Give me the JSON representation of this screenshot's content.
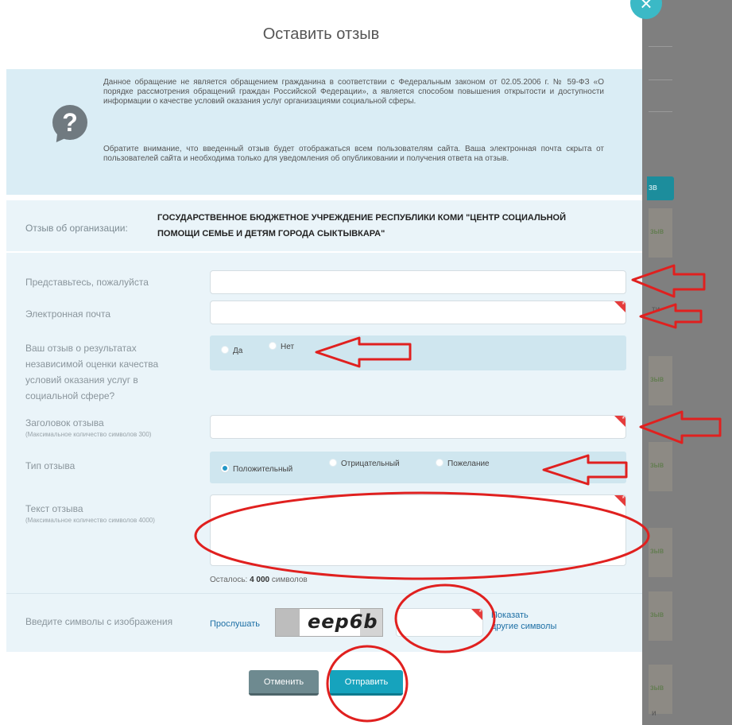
{
  "modal": {
    "title": "Оставить отзыв",
    "close_icon": "×",
    "info": {
      "icon": "?",
      "paragraph1": "Данное обращение не является обращением гражданина в соответствии с Федеральным законом от 02.05.2006 г. № 59-ФЗ «О порядке рассмотрения обращений граждан Российской Федерации», а является способом повышения открытости и доступности информации о качестве условий оказания услуг организациями социальной сферы.",
      "paragraph2": "Обратите внимание, что введенный отзыв будет отображаться всем пользователям сайта. Ваша электронная почта скрыта от пользователей сайта и необходима только для уведомления об опубликовании и получения ответа на отзыв."
    },
    "organization": {
      "label": "Отзыв об организации:",
      "name": "ГОСУДАРСТВЕННОЕ БЮДЖЕТНОЕ УЧРЕЖДЕНИЕ РЕСПУБЛИКИ КОМИ \"ЦЕНТР СОЦИАЛЬНОЙ ПОМОЩИ СЕМЬЕ И ДЕТЯМ ГОРОДА СЫКТЫВКАРА\""
    },
    "form": {
      "name_label": "Представьтесь, пожалуйста",
      "name_value": "",
      "email_label": "Электронная почта",
      "email_value": "",
      "independent_label": "Ваш отзыв о результатах независимой оценки качества условий оказания услуг в социальной сфере?",
      "independent_yes": "Да",
      "independent_no": "Нет",
      "subject_label": "Заголовок отзыва",
      "subject_hint": "(Максимальное количество символов 300)",
      "subject_value": "",
      "type_label": "Тип отзыва",
      "type_positive": "Положительный",
      "type_negative": "Отрицательный",
      "type_wish": "Пожелание",
      "type_selected": "Положительный",
      "text_label": "Текст отзыва",
      "text_hint": "(Максимальное количество символов 4000)",
      "text_value": "",
      "remaining_prefix": "Осталось:",
      "remaining_count": "4 000",
      "remaining_suffix": "символов"
    },
    "captcha": {
      "label": "Введите символы с изображения",
      "listen": "Прослушать",
      "image_text": "eep6b",
      "input_value": "",
      "show_other_line1": "Показать",
      "show_other_line2": "другие символы"
    },
    "buttons": {
      "cancel": "Отменить",
      "send": "Отправить"
    }
  },
  "backdrop": {
    "button_text": "зв",
    "panel_text": "зыв",
    "fragment1": "ти",
    "fragment2": "и"
  },
  "colors": {
    "accent": "#16a3bd",
    "info_bg": "#daedf5",
    "form_bg": "#eaf4f9",
    "required_marker": "#e53b3b",
    "annotation": "#e0201f"
  },
  "icons": {
    "close": "close-icon",
    "info": "question-icon",
    "required": "required-marker-icon"
  }
}
